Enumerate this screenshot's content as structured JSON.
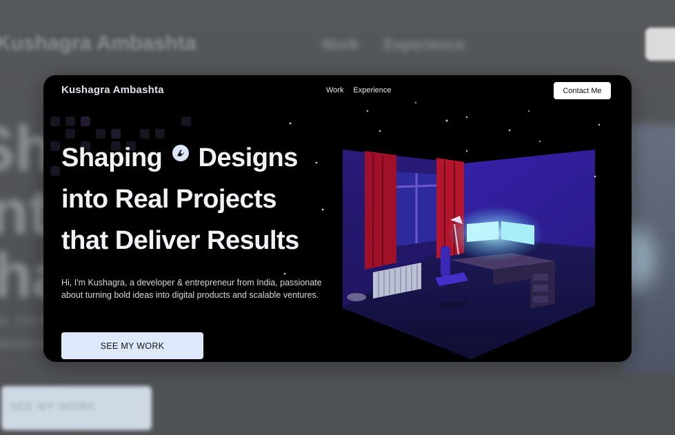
{
  "header": {
    "brand": "Kushagra Ambashta",
    "nav": [
      "Work",
      "Experience"
    ],
    "contact_label": "Contact Me"
  },
  "hero": {
    "line1_a": "Shaping",
    "line1_b": "Designs",
    "line2": "into Real Projects",
    "line3": "that Deliver Results",
    "subtitle_1": "Hi, I'm Kushagra, a developer & entrepreneur from India, passionate",
    "subtitle_2": "about turning bold ideas into digital products and scalable ventures.",
    "cta_label": "SEE MY WORK"
  },
  "colors": {
    "card_bg": "#000000",
    "cta_bg": "#dde9fb",
    "room_wall": "#3a1f9e",
    "curtain": "#b0122a",
    "screen_glow": "#a7f2ff"
  },
  "icons": [
    "tinted-logo-icon"
  ]
}
